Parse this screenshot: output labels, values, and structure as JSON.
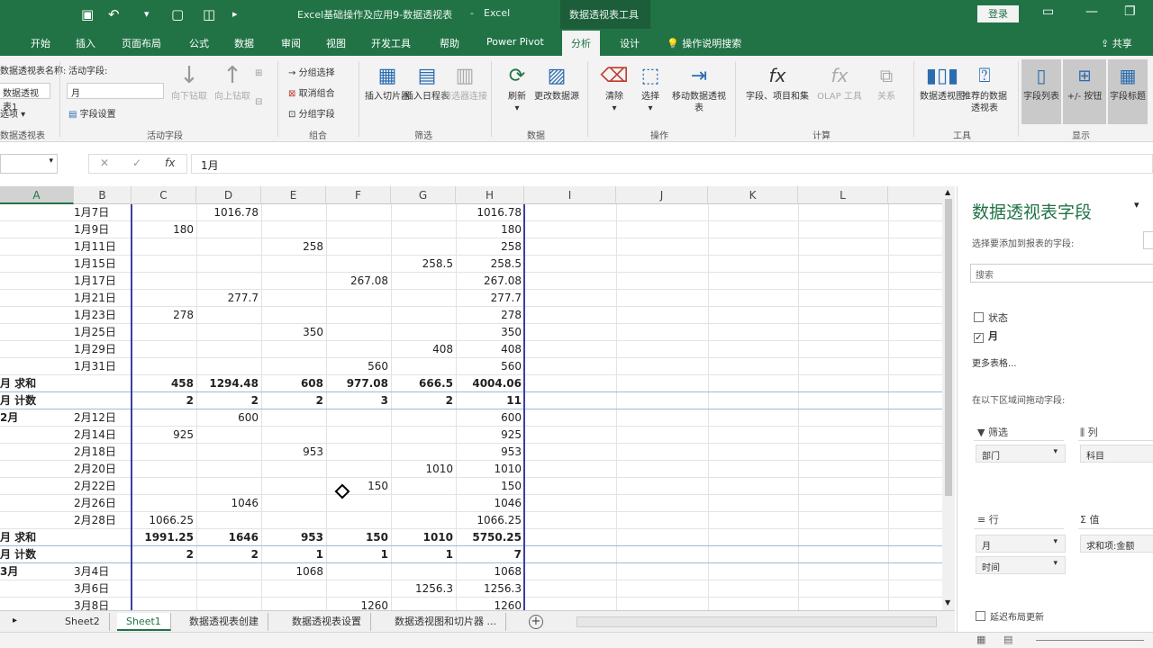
{
  "window": {
    "title": "Excel基础操作及应用9-数据透视表",
    "app": "Excel",
    "tools_tag": "数据透视表工具",
    "login": "登录"
  },
  "tabs": [
    "开始",
    "插入",
    "页面布局",
    "公式",
    "数据",
    "审阅",
    "视图",
    "开发工具",
    "帮助",
    "Power Pivot",
    "分析",
    "设计"
  ],
  "active_tab": "分析",
  "tell_me": "操作说明搜索",
  "share": "共享",
  "ribbon": {
    "pivot_name_label": "数据透视表名称:",
    "pivot_name": "数据透视表1",
    "options": "选项",
    "group_pivot": "数据透视表",
    "active_field_label": "活动字段:",
    "active_field": "月",
    "field_settings": "字段设置",
    "drill_down": "向下钻取",
    "drill_up": "向上钻取",
    "group_active": "活动字段",
    "group_selection": "分组选择",
    "ungroup": "取消组合",
    "group_field": "分组字段",
    "group_group": "组合",
    "insert_slicer": "插入切片器",
    "insert_timeline": "插入日程表",
    "filter_conn": "筛选器连接",
    "group_filter": "筛选",
    "refresh": "刷新",
    "change_source": "更改数据源",
    "group_data": "数据",
    "clear": "清除",
    "select": "选择",
    "move_pivot": "移动数据透视表",
    "group_actions": "操作",
    "fields_items": "字段、项目和集",
    "olap": "OLAP 工具",
    "relations": "关系",
    "group_calc": "计算",
    "pivot_chart": "数据透视图",
    "recommended": "推荐的数据透视表",
    "group_tools": "工具",
    "field_list": "字段列表",
    "plus_minus": "+/- 按钮",
    "field_headers": "字段标题",
    "group_show": "显示"
  },
  "formula_bar": {
    "value": "1月",
    "fx": "fx"
  },
  "columns": [
    "A",
    "B",
    "C",
    "D",
    "E",
    "F",
    "G",
    "H",
    "I",
    "J",
    "K",
    "L"
  ],
  "rows": [
    {
      "a": "",
      "b": "1月7日",
      "c": "",
      "d": "1016.78",
      "e": "",
      "f": "",
      "g": "",
      "h": "1016.78"
    },
    {
      "a": "",
      "b": "1月9日",
      "c": "180",
      "d": "",
      "e": "",
      "f": "",
      "g": "",
      "h": "180"
    },
    {
      "a": "",
      "b": "1月11日",
      "c": "",
      "d": "",
      "e": "258",
      "f": "",
      "g": "",
      "h": "258"
    },
    {
      "a": "",
      "b": "1月15日",
      "c": "",
      "d": "",
      "e": "",
      "f": "",
      "g": "258.5",
      "h": "258.5"
    },
    {
      "a": "",
      "b": "1月17日",
      "c": "",
      "d": "",
      "e": "",
      "f": "267.08",
      "g": "",
      "h": "267.08"
    },
    {
      "a": "",
      "b": "1月21日",
      "c": "",
      "d": "277.7",
      "e": "",
      "f": "",
      "g": "",
      "h": "277.7"
    },
    {
      "a": "",
      "b": "1月23日",
      "c": "278",
      "d": "",
      "e": "",
      "f": "",
      "g": "",
      "h": "278"
    },
    {
      "a": "",
      "b": "1月25日",
      "c": "",
      "d": "",
      "e": "350",
      "f": "",
      "g": "",
      "h": "350"
    },
    {
      "a": "",
      "b": "1月29日",
      "c": "",
      "d": "",
      "e": "",
      "f": "",
      "g": "408",
      "h": "408"
    },
    {
      "a": "",
      "b": "1月31日",
      "c": "",
      "d": "",
      "e": "",
      "f": "560",
      "g": "",
      "h": "560"
    },
    {
      "a": "月 求和",
      "b": "",
      "c": "458",
      "d": "1294.48",
      "e": "608",
      "f": "977.08",
      "g": "666.5",
      "h": "4004.06",
      "sum": true
    },
    {
      "a": "月 计数",
      "b": "",
      "c": "2",
      "d": "2",
      "e": "2",
      "f": "3",
      "g": "2",
      "h": "11",
      "sum": true
    },
    {
      "a": "2月",
      "b": "2月12日",
      "c": "",
      "d": "600",
      "e": "",
      "f": "",
      "g": "",
      "h": "600"
    },
    {
      "a": "",
      "b": "2月14日",
      "c": "925",
      "d": "",
      "e": "",
      "f": "",
      "g": "",
      "h": "925"
    },
    {
      "a": "",
      "b": "2月18日",
      "c": "",
      "d": "",
      "e": "953",
      "f": "",
      "g": "",
      "h": "953"
    },
    {
      "a": "",
      "b": "2月20日",
      "c": "",
      "d": "",
      "e": "",
      "f": "",
      "g": "1010",
      "h": "1010"
    },
    {
      "a": "",
      "b": "2月22日",
      "c": "",
      "d": "",
      "e": "",
      "f": "150",
      "g": "",
      "h": "150"
    },
    {
      "a": "",
      "b": "2月26日",
      "c": "",
      "d": "1046",
      "e": "",
      "f": "",
      "g": "",
      "h": "1046"
    },
    {
      "a": "",
      "b": "2月28日",
      "c": "1066.25",
      "d": "",
      "e": "",
      "f": "",
      "g": "",
      "h": "1066.25"
    },
    {
      "a": "月 求和",
      "b": "",
      "c": "1991.25",
      "d": "1646",
      "e": "953",
      "f": "150",
      "g": "1010",
      "h": "5750.25",
      "sum": true
    },
    {
      "a": "月 计数",
      "b": "",
      "c": "2",
      "d": "2",
      "e": "1",
      "f": "1",
      "g": "1",
      "h": "7",
      "sum": true
    },
    {
      "a": "3月",
      "b": "3月4日",
      "c": "",
      "d": "",
      "e": "1068",
      "f": "",
      "g": "",
      "h": "1068"
    },
    {
      "a": "",
      "b": "3月6日",
      "c": "",
      "d": "",
      "e": "",
      "f": "",
      "g": "1256.3",
      "h": "1256.3"
    },
    {
      "a": "",
      "b": "3月8日",
      "c": "",
      "d": "",
      "e": "",
      "f": "1260",
      "g": "",
      "h": "1260"
    }
  ],
  "sheet_tabs": [
    "Sheet2",
    "Sheet1",
    "数据透视表创建",
    "数据透视表设置",
    "数据透视图和切片器 ..."
  ],
  "active_sheet": "Sheet1",
  "pane": {
    "title": "数据透视表字段",
    "subtitle": "选择要添加到报表的字段:",
    "search_placeholder": "搜索",
    "fields": [
      {
        "label": "状态",
        "checked": false
      },
      {
        "label": "月",
        "checked": true
      }
    ],
    "more_tables": "更多表格...",
    "drag_hint": "在以下区域间拖动字段:",
    "filter_hd": "筛选",
    "columns_hd": "列",
    "rows_hd": "行",
    "values_hd": "值",
    "filter_items": [
      "部门"
    ],
    "column_items": [
      "科目"
    ],
    "row_items": [
      "月",
      "时间"
    ],
    "value_items": [
      "求和项:金额"
    ],
    "defer": "延迟布局更新"
  },
  "colors": {
    "excel_green": "#217346",
    "pivot_border": "#3b3fa0"
  }
}
